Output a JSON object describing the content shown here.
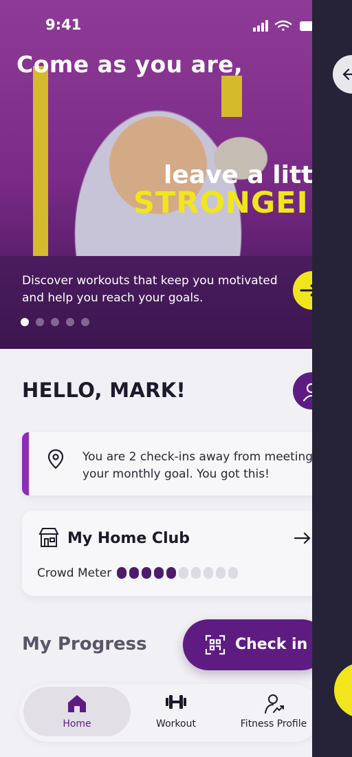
{
  "status": {
    "time": "9:41"
  },
  "hero": {
    "headline_1": "Come as you are,",
    "headline_2": "leave a litt",
    "headline_3": "STRONGEI",
    "description": "Discover workouts that keep you motivated and help you reach your goals.",
    "slides": 5,
    "active_slide": 1
  },
  "greeting": "HELLO, MARK!",
  "goal_card": {
    "icon": "location-pin-icon",
    "message": "You are 2 check-ins away from meeting your monthly goal. You got this!"
  },
  "home_club": {
    "title": "My Home Club",
    "crowd_label": "Crowd Meter",
    "crowd_level": 5,
    "crowd_max": 10
  },
  "progress_title": "My Progress",
  "checkin_label": "Check in",
  "tabs": [
    {
      "label": "Home",
      "icon": "home-icon",
      "active": true
    },
    {
      "label": "Workout",
      "icon": "dumbbell-icon",
      "active": false
    },
    {
      "label": "Fitness Profile",
      "icon": "fitness-profile-icon",
      "active": false
    }
  ],
  "colors": {
    "brand_purple": "#5e1c83",
    "accent_yellow": "#f1e61d",
    "goal_accent": "#8e2bb7"
  }
}
